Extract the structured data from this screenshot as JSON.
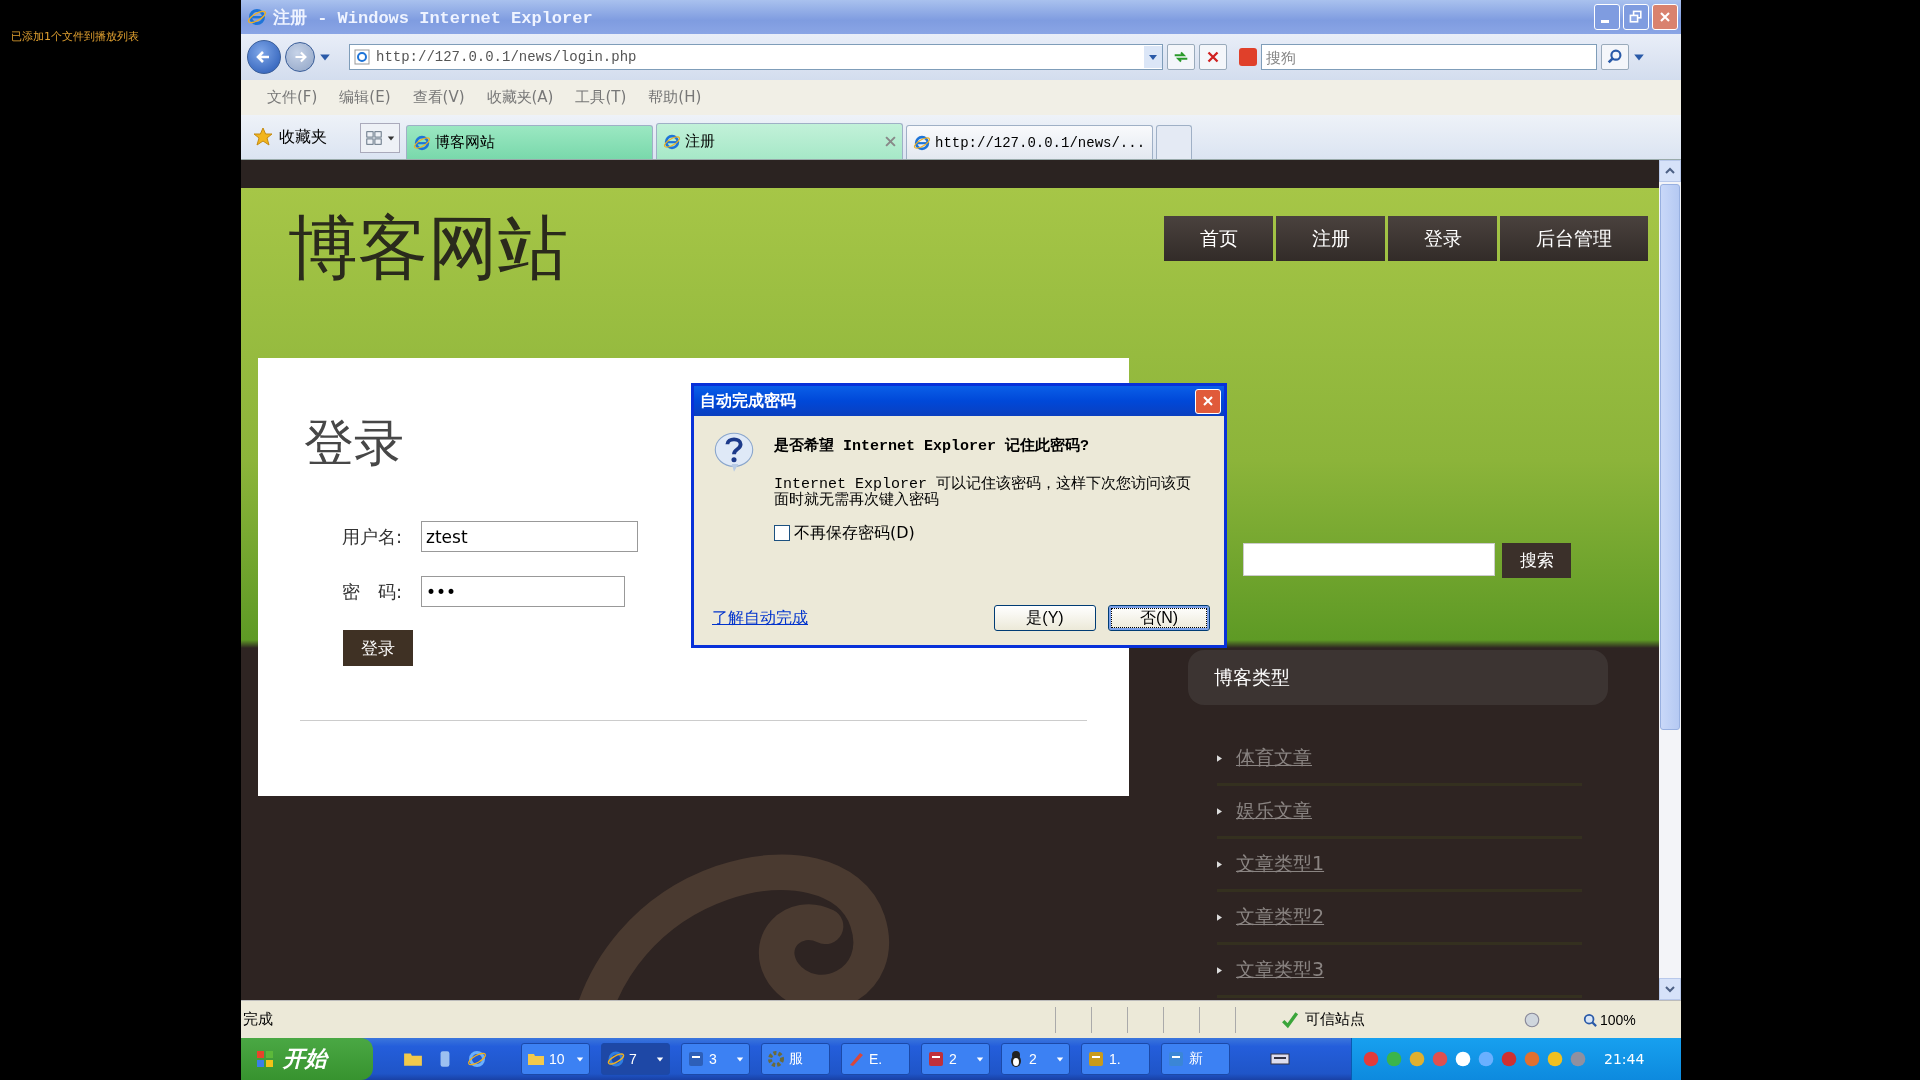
{
  "overlay_note": "已添加1个文件到播放列表",
  "window": {
    "title": "注册 - Windows Internet Explorer"
  },
  "address_bar": {
    "url": "http://127.0.0.1/news/login.php",
    "search_placeholder": "搜狗"
  },
  "menu": [
    "文件(F)",
    "编辑(E)",
    "查看(V)",
    "收藏夹(A)",
    "工具(T)",
    "帮助(H)"
  ],
  "favorites_label": "收藏夹",
  "tabs": [
    {
      "label": "博客网站",
      "selected": false,
      "grouped": true
    },
    {
      "label": "注册",
      "selected": true,
      "grouped": true
    },
    {
      "label": "http://127.0.0.1/news/...",
      "selected": false,
      "grouped": false
    }
  ],
  "page": {
    "site_title": "博客网站",
    "nav": [
      "首页",
      "注册",
      "登录",
      "后台管理"
    ],
    "login": {
      "heading": "登录",
      "username_label": "用户名:",
      "username_value": "ztest",
      "password_label": "密　码:",
      "password_value": "•••",
      "button": "登录"
    },
    "search_button": "搜索",
    "sidebar": {
      "title": "博客类型",
      "items": [
        "体育文章",
        "娱乐文章",
        "文章类型1",
        "文章类型2",
        "文章类型3"
      ]
    }
  },
  "dialog": {
    "title": "自动完成密码",
    "question": "是否希望 Internet Explorer 记住此密码?",
    "body": "Internet Explorer 可以记住该密码，这样下次您访问该页面时就无需再次键入密码",
    "checkbox_label": "不再保存密码(D)",
    "checked": false,
    "link": "了解自动完成",
    "buttons": [
      {
        "label": "是(Y)",
        "focused": false
      },
      {
        "label": "否(N)",
        "focused": true
      }
    ]
  },
  "status_bar": {
    "text": "完成",
    "zone": "可信站点",
    "zoom": "100%"
  },
  "taskbar": {
    "start": "开始",
    "tasks": [
      {
        "kind": "folder",
        "label": "10",
        "grouped": true
      },
      {
        "kind": "browser",
        "label": "7",
        "grouped": true
      },
      {
        "kind": "document",
        "label": "3",
        "grouped": true
      },
      {
        "kind": "gear",
        "label": "服",
        "grouped": false
      },
      {
        "kind": "brush",
        "label": "E.",
        "grouped": false
      },
      {
        "kind": "page",
        "label": "2",
        "grouped": true
      },
      {
        "kind": "figure",
        "label": "2",
        "grouped": true
      },
      {
        "kind": "flash",
        "label": "1.",
        "grouped": false
      },
      {
        "kind": "file",
        "label": "新",
        "grouped": false
      }
    ],
    "clock": "21:44"
  }
}
